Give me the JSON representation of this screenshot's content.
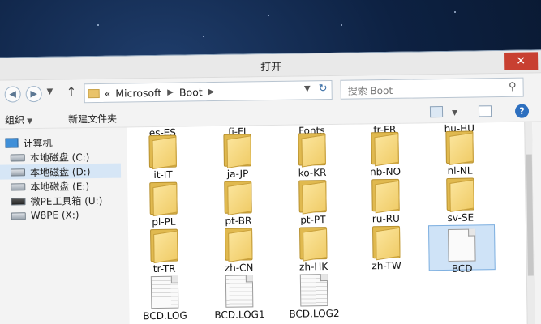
{
  "dialog": {
    "title": "打开",
    "close_label": "✕"
  },
  "address": {
    "chevrons": "«",
    "crumbs": [
      "Microsoft",
      "Boot"
    ],
    "search_placeholder": "搜索 Boot"
  },
  "toolbar": {
    "organize": "组织",
    "new_folder": "新建文件夹",
    "help": "?"
  },
  "nav": {
    "items": [
      {
        "label": "计算机",
        "icon": "computer-icon"
      },
      {
        "label": "本地磁盘 (C:)",
        "icon": "drive-icon"
      },
      {
        "label": "本地磁盘 (D:)",
        "icon": "drive-icon"
      },
      {
        "label": "本地磁盘 (E:)",
        "icon": "drive-icon"
      },
      {
        "label": "微PE工具箱 (U:)",
        "icon": "usb-drive-icon"
      },
      {
        "label": "W8PE (X:)",
        "icon": "drive-icon"
      }
    ]
  },
  "files": [
    {
      "name": "es-ES",
      "type": "folder"
    },
    {
      "name": "fi-FI",
      "type": "folder"
    },
    {
      "name": "Fonts",
      "type": "folder"
    },
    {
      "name": "fr-FR",
      "type": "folder"
    },
    {
      "name": "hu-HU",
      "type": "folder"
    },
    {
      "name": "it-IT",
      "type": "folder"
    },
    {
      "name": "ja-JP",
      "type": "folder"
    },
    {
      "name": "ko-KR",
      "type": "folder"
    },
    {
      "name": "nb-NO",
      "type": "folder"
    },
    {
      "name": "nl-NL",
      "type": "folder"
    },
    {
      "name": "pl-PL",
      "type": "folder"
    },
    {
      "name": "pt-BR",
      "type": "folder"
    },
    {
      "name": "pt-PT",
      "type": "folder"
    },
    {
      "name": "ru-RU",
      "type": "folder"
    },
    {
      "name": "sv-SE",
      "type": "folder"
    },
    {
      "name": "tr-TR",
      "type": "folder"
    },
    {
      "name": "zh-CN",
      "type": "folder"
    },
    {
      "name": "zh-HK",
      "type": "folder"
    },
    {
      "name": "zh-TW",
      "type": "folder"
    },
    {
      "name": "BCD",
      "type": "file",
      "selected": true
    },
    {
      "name": "BCD.LOG",
      "type": "log"
    },
    {
      "name": "BCD.LOG1",
      "type": "log"
    },
    {
      "name": "BCD.LOG2",
      "type": "log"
    }
  ]
}
